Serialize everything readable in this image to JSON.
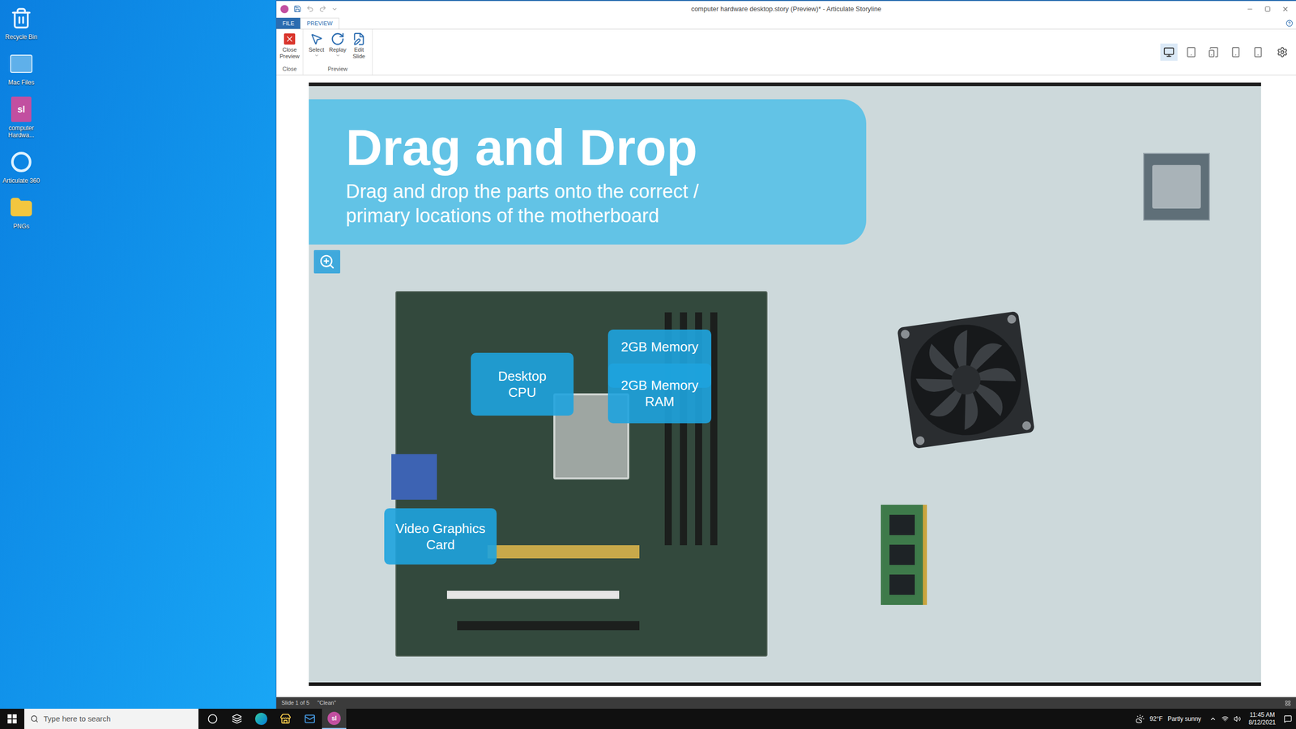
{
  "desktop": {
    "icons": [
      {
        "label": "Recycle Bin",
        "kind": "recycle"
      },
      {
        "label": "Mac Files",
        "kind": "mac"
      },
      {
        "label": "computer Hardwa...",
        "kind": "story",
        "glyph": "sl"
      },
      {
        "label": "Articulate 360",
        "kind": "articulate"
      },
      {
        "label": "PNGs",
        "kind": "folder"
      }
    ]
  },
  "window": {
    "title": "computer hardware desktop.story (Preview)* - Articulate Storyline"
  },
  "tabs": [
    {
      "label": "FILE",
      "selected": false
    },
    {
      "label": "PREVIEW",
      "selected": true
    }
  ],
  "ribbon": {
    "groups": [
      {
        "label": "Close",
        "buttons": [
          {
            "label": "Close Preview",
            "kind": "close",
            "dropdown": false
          }
        ]
      },
      {
        "label": "Preview",
        "buttons": [
          {
            "label": "Select",
            "kind": "select",
            "dropdown": true
          },
          {
            "label": "Replay",
            "kind": "replay",
            "dropdown": true
          },
          {
            "label": "Edit Slide",
            "kind": "edit",
            "dropdown": false
          }
        ]
      }
    ],
    "devices": [
      {
        "kind": "desktop",
        "selected": true
      },
      {
        "kind": "tablet-landscape",
        "selected": false
      },
      {
        "kind": "tablet-portrait",
        "selected": false
      },
      {
        "kind": "phone-landscape",
        "selected": false
      },
      {
        "kind": "phone-portrait",
        "selected": false
      }
    ]
  },
  "slide": {
    "title": "Drag and Drop",
    "subtitle_lines": [
      "Drag and drop the parts onto the correct /",
      "primary locations of the motherboard"
    ],
    "drop_targets": [
      {
        "lines": [
          "Desktop",
          "CPU"
        ]
      },
      {
        "lines": [
          "2GB Memory"
        ]
      },
      {
        "lines": [
          "2GB Memory",
          "RAM"
        ]
      },
      {
        "lines": [
          "Video Graphics",
          "Card"
        ]
      }
    ],
    "drag_items": [
      {
        "kind": "cpu"
      },
      {
        "kind": "fan"
      },
      {
        "kind": "ram"
      }
    ]
  },
  "status_bar": {
    "items": [
      "Slide 1 of 5",
      "\"Clean\""
    ]
  },
  "taskbar": {
    "search": {
      "placeholder": "Type here to search"
    },
    "apps": [
      {
        "kind": "cortana",
        "active": false
      },
      {
        "kind": "taskview",
        "active": false
      },
      {
        "kind": "edge",
        "active": false
      },
      {
        "kind": "store",
        "active": false
      },
      {
        "kind": "mail",
        "active": false
      },
      {
        "kind": "storyline",
        "glyph": "sl",
        "active": true
      }
    ],
    "weather": {
      "temp": "92°F",
      "text": "Partly sunny"
    },
    "clock": {
      "time": "11:45 AM",
      "date": "8/12/2021"
    }
  }
}
